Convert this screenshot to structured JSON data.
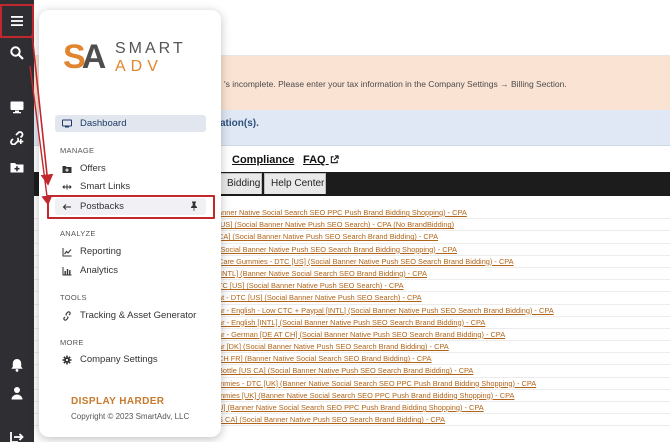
{
  "rail": {
    "icons": [
      "menu-icon",
      "search-icon",
      "monitor-icon",
      "link-add-icon",
      "folder-add-icon",
      "bell-icon",
      "user-icon",
      "exit-icon"
    ]
  },
  "background": {
    "tax_notice": "'s incomplete. Please enter your tax information in the Company Settings → Billing Section.",
    "info_notice": "ation(s).",
    "menu": [
      "Compliance",
      "FAQ"
    ],
    "tabs": [
      "Bidding",
      "Help Center"
    ],
    "links": [
      "anner Native Social Search SEO PPC Push Brand Bidding Shopping) - CPA",
      "[US] (Social Banner Native Push SEO Search) - CPA (No BrandBidding)",
      "CA] (Social Banner Native Push SEO Search Brand Bidding) - CPA",
      "(Social Banner Native Push SEO Search Brand Bidding Shopping) - CPA",
      "Care Gummies - DTC [US] (Social Banner Native Push SEO Search Brand Bidding) - CPA",
      "[INTL] (Banner Native Social Search SEO Brand Bidding) - CPA",
      "TC [US] (Social Banner Native Push SEO Search) - CPA",
      "at - DTC [US] (Social Banner Native Push SEO Search) - CPA",
      "ar - English - Low CTC + Paypal [INTL] (Social Banner Native Push SEO Search Brand Bidding) - CPA",
      "ar - English [INTL] (Social Banner Native Push SEO Search Brand Bidding) - CPA",
      "ar - German [DE AT CH] (Social Banner Native Push SEO Search Brand Bidding) - CPA",
      "ar [DK] (Social Banner Native Push SEO Search Brand Bidding) - CPA",
      "CH FR] (Banner Native Social Search SEO Brand Bidding) - CPA",
      "Bottle [US CA] (Social Banner Native Push SEO Search Brand Bidding) - CPA",
      "mmies - DTC [UK] (Banner Native Social Search SEO PPC Push Brand Bidding Shopping) - CPA",
      "mmies [UK] (Banner Native Social Search SEO PPC Push Brand Bidding Shopping) - CPA",
      "U] (Banner Native Social Search SEO PPC Push Brand Bidding Shopping) - CPA",
      "S CA] (Social Banner Native Push SEO Search Brand Bidding) - CPA"
    ]
  },
  "panel": {
    "logo": {
      "mark_s": "S",
      "mark_a": "A",
      "word1": "SMART",
      "word2": "ADV"
    },
    "dashboard": "Dashboard",
    "sections": {
      "manage": "MANAGE",
      "analyze": "ANALYZE",
      "tools": "TOOLS",
      "more": "MORE"
    },
    "manage_items": [
      "Offers",
      "Smart Links",
      "Postbacks"
    ],
    "analyze_items": [
      "Reporting",
      "Analytics"
    ],
    "tools_items": [
      "Tracking & Asset Generator"
    ],
    "more_items": [
      "Company Settings"
    ],
    "footer_brand": "DISPLAY HARDER",
    "copyright": "Copyright © 2023 SmartAdv, LLC"
  },
  "colors": {
    "rail": "#2f2f33",
    "highlight": "#c0282e",
    "brand_orange": "#e1852f",
    "link_orange": "#b1651a"
  }
}
